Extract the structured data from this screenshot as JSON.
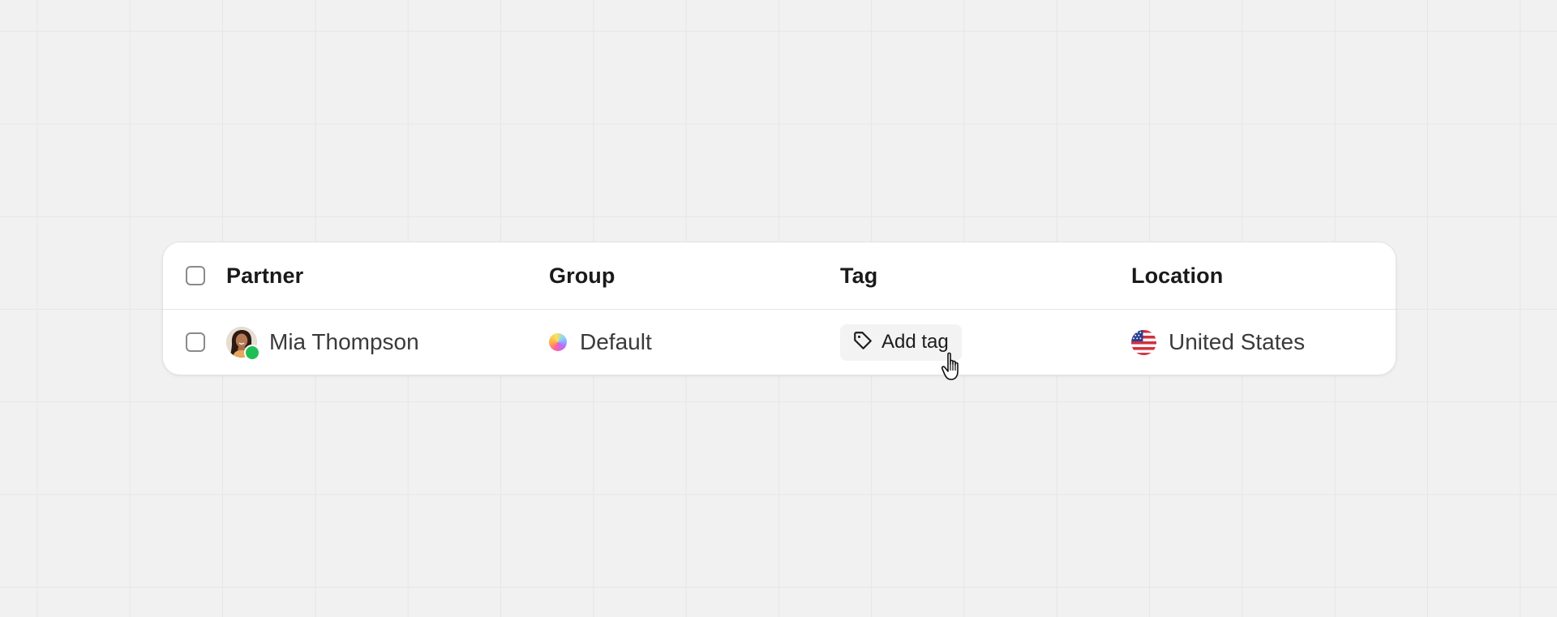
{
  "table": {
    "columns": {
      "partner": "Partner",
      "group": "Group",
      "tag": "Tag",
      "location": "Location"
    },
    "rows": [
      {
        "partner_name": "Mia Thompson",
        "status": "online",
        "group": "Default",
        "tag_button_label": "Add tag",
        "location": "United States",
        "flag_icon": "us-flag-icon"
      }
    ]
  },
  "colors": {
    "status_online": "#1fbf55",
    "background": "#f1f1f1"
  }
}
